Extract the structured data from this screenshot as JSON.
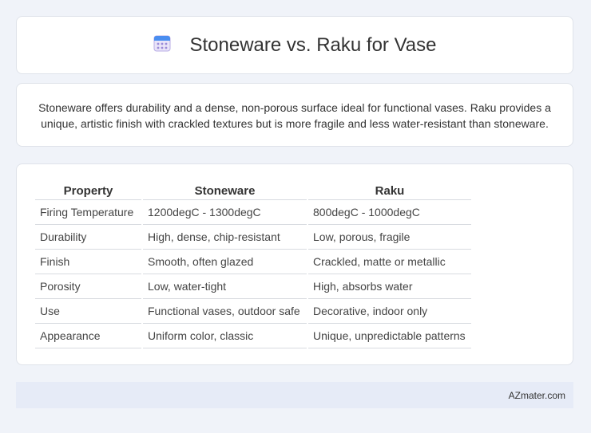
{
  "header": {
    "title": "Stoneware vs. Raku for Vase",
    "icon": "calendar-icon"
  },
  "intro": {
    "text": "Stoneware offers durability and a dense, non-porous surface ideal for functional vases. Raku provides a unique, artistic finish with crackled textures but is more fragile and less water-resistant than stoneware."
  },
  "table": {
    "headers": [
      "Property",
      "Stoneware",
      "Raku"
    ],
    "rows": [
      [
        "Firing Temperature",
        "1200degC - 1300degC",
        "800degC - 1000degC"
      ],
      [
        "Durability",
        "High, dense, chip-resistant",
        "Low, porous, fragile"
      ],
      [
        "Finish",
        "Smooth, often glazed",
        "Crackled, matte or metallic"
      ],
      [
        "Porosity",
        "Low, water-tight",
        "High, absorbs water"
      ],
      [
        "Use",
        "Functional vases, outdoor safe",
        "Decorative, indoor only"
      ],
      [
        "Appearance",
        "Uniform color, classic",
        "Unique, unpredictable patterns"
      ]
    ]
  },
  "footer": {
    "brand": "AZmater.com"
  }
}
